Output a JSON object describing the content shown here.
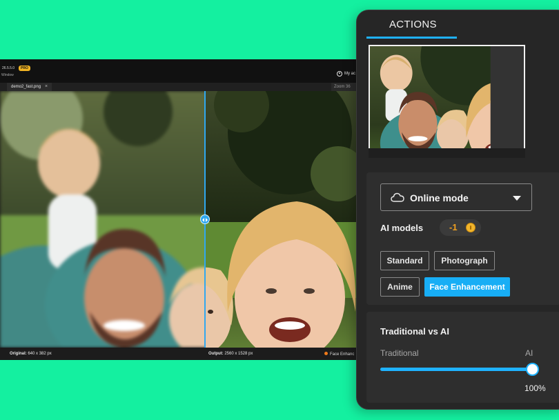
{
  "app": {
    "version": "26.5.5.0",
    "badge": "PRO",
    "window_label": "Window",
    "account": "My ac",
    "file_tab": "demo2_fast.png",
    "zoom_label": "Zoom  36"
  },
  "statusbar": {
    "original_label": "Original:",
    "original_value": "640 x 382 px",
    "output_label": "Output:",
    "output_value": "2560 x 1528 px",
    "mode": "Face Enhanc"
  },
  "panel": {
    "tab": "ACTIONS",
    "mode_select": "Online mode",
    "models_title": "AI models",
    "credit": "-1",
    "models": [
      {
        "label": "Standard",
        "active": false
      },
      {
        "label": "Photograph",
        "active": false
      },
      {
        "label": "Anime",
        "active": false
      },
      {
        "label": "Face Enhancement",
        "active": true
      }
    ],
    "slider": {
      "title": "Traditional vs AI",
      "left_label": "Traditional",
      "right_label": "AI",
      "value": 100,
      "value_text": "100%"
    }
  },
  "colors": {
    "background": "#14f0a0",
    "accent": "#1fb2ff",
    "credit": "#f0a020"
  }
}
